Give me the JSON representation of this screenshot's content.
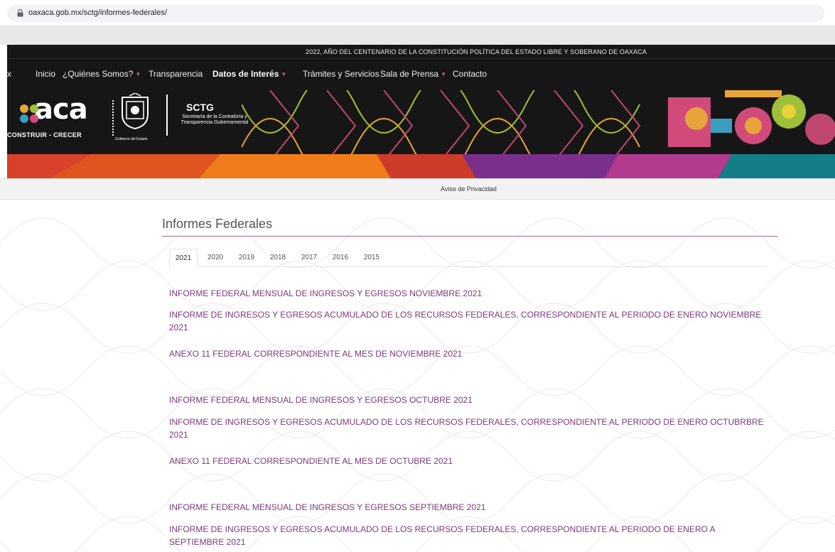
{
  "browser": {
    "url": "oaxaca.gob.mx/sctg/informes-federales/"
  },
  "header": {
    "announcement": "2022, AÑO DEL CENTENARIO DE LA CONSTITUCIÓN POLÍTICA DEL ESTADO LIBRE Y SOBERANO DE OAXACA",
    "nav_partial": "mx",
    "nav": [
      {
        "label": "Inicio"
      },
      {
        "label": "¿Quiénes Somos?"
      },
      {
        "label": "Transparencia"
      },
      {
        "label": "Datos de Interés"
      },
      {
        "label": "Trámites y Servicios"
      },
      {
        "label": "Sala de Prensa"
      },
      {
        "label": "Contacto"
      }
    ],
    "logo_word": "aca",
    "logo_tagline": "CONSTRUIR - CRECER",
    "gobierno": "Gobierno del Estado",
    "sctg_title": "SCTG",
    "sctg_subtitle": "Secretaría de la Contraloría y Transparencia Gubernamental"
  },
  "privacy": {
    "label": "Aviso de Privacidad"
  },
  "main": {
    "title": "Informes Federales",
    "tabs": [
      "2021",
      "2020",
      "2019",
      "2018",
      "2017",
      "2016",
      "2015"
    ],
    "active_tab": "2021",
    "links": [
      "INFORME FEDERAL MENSUAL DE INGRESOS Y EGRESOS NOVIEMBRE 2021",
      "INFORME DE INGRESOS Y EGRESOS ACUMULADO DE LOS RECURSOS FEDERALES, CORRESPONDIENTE AL PERIODO DE ENERO NOVIEMBRE 2021",
      "ANEXO 11 FEDERAL CORRESPONDIENTE AL MES DE NOVIEMBRE 2021",
      "INFORME FEDERAL MENSUAL DE INGRESOS Y EGRESOS OCTUBRE 2021",
      "INFORME DE INGRESOS Y EGRESOS ACUMULADO DE LOS RECURSOS FEDERALES, CORRESPONDIENTE AL PERIODO DE ENERO OCTUBRBRE 2021",
      "ANEXO 11 FEDERAL CORRESPONDIENTE AL MES DE OCTUBRE 2021",
      "INFORME FEDERAL MENSUAL DE INGRESOS Y EGRESOS SEPTIEMBRE 2021",
      "INFORME DE INGRESOS Y EGRESOS ACUMULADO DE LOS RECURSOS FEDERALES, CORRESPONDIENTE AL PERIODO DE ENERO A SEPTIEMBRE 2021"
    ]
  },
  "colors": {
    "link": "#7b3a7a",
    "accent_rule": "#9b6d97",
    "header_bg": "#161616"
  }
}
